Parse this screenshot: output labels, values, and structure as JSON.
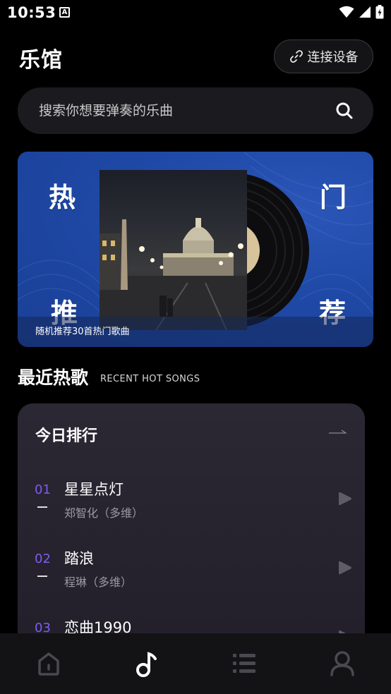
{
  "status_bar": {
    "time": "10:53",
    "notification": "A"
  },
  "header": {
    "title": "乐馆",
    "connect_label": "连接设备"
  },
  "search": {
    "placeholder": "搜索你想要弹奏的乐曲"
  },
  "banner": {
    "chars": [
      "热",
      "门",
      "推",
      "荐"
    ],
    "caption": "随机推荐30首热门歌曲"
  },
  "recent": {
    "title": "最近热歌",
    "subtitle": "RECENT HOT SONGS"
  },
  "chart": {
    "title": "今日排行",
    "songs": [
      {
        "num": "01",
        "title": "星星点灯",
        "artist": "郑智化（多维）"
      },
      {
        "num": "02",
        "title": "踏浪",
        "artist": "程琳（多维）"
      },
      {
        "num": "03",
        "title": "恋曲1990",
        "artist": ""
      }
    ]
  },
  "nav": {
    "items": [
      "home-icon",
      "music-note-icon",
      "list-icon",
      "profile-icon"
    ],
    "active": 1
  },
  "colors": {
    "accent": "#7d5cf0",
    "banner": "#1f49a6",
    "card": "#27242f"
  }
}
